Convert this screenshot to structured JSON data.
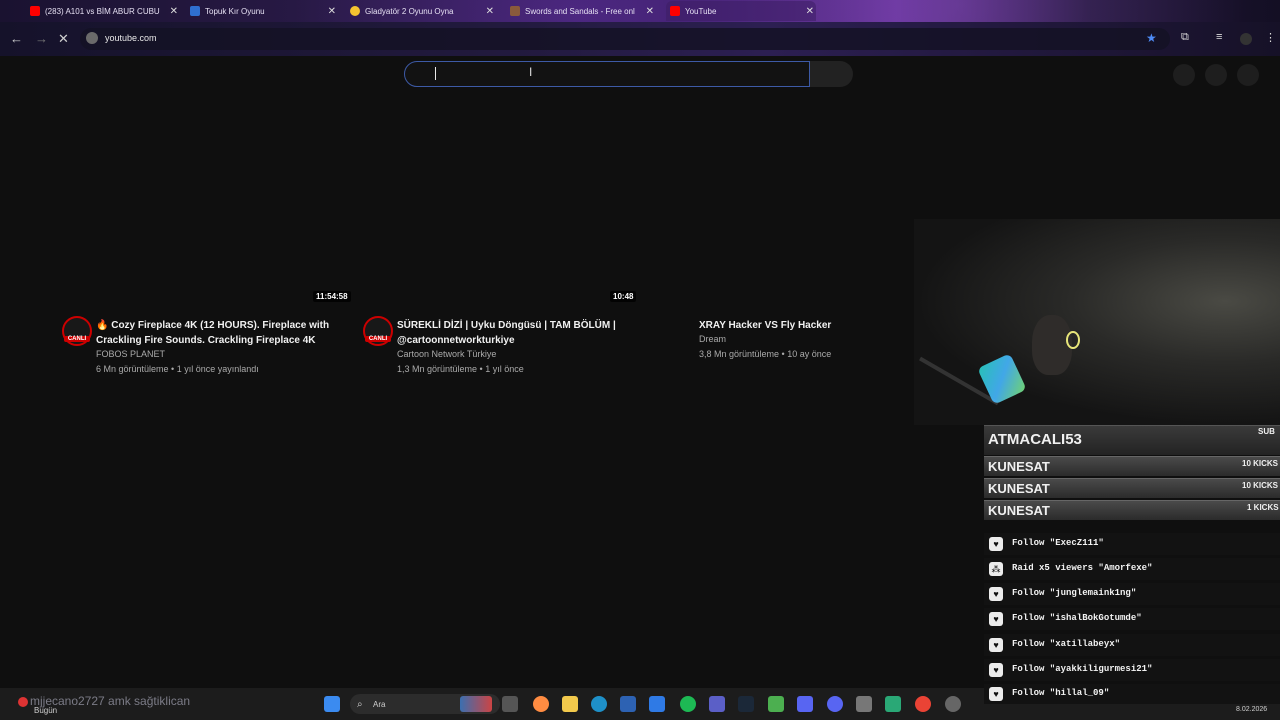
{
  "browser": {
    "tabs": [
      {
        "title": "(283) A101 vs BİM ABUR CUBU",
        "favicon_color": "#ff0000"
      },
      {
        "title": "Topuk Kır Oyunu",
        "favicon_color": "#2f6fcf"
      },
      {
        "title": "Gladyatör 2 Oyunu Oyna",
        "favicon_color": "#f4c430"
      },
      {
        "title": "Swords and Sandals - Free onl",
        "favicon_color": "#8a5a3c"
      },
      {
        "title": "YouTube",
        "favicon_color": "#ff0000"
      }
    ],
    "url": "youtube.com"
  },
  "youtube": {
    "search_value": "",
    "videos": [
      {
        "duration": "11:54:58",
        "title_line1": "🔥 Cozy Fireplace 4K (12 HOURS). Fireplace with",
        "title_line2": "Crackling Fire Sounds. Crackling Fireplace 4K",
        "channel": "FOBOS PLANET",
        "meta": "6 Mn görüntüleme • 1 yıl önce yayınlandı",
        "live_label": "CANLI"
      },
      {
        "duration": "10:48",
        "title_line1": "SÜREKLİ DİZİ | Uyku Döngüsü | TAM BÖLÜM |",
        "title_line2": "@cartoonnetworkturkiye",
        "channel": "Cartoon Network Türkiye",
        "meta": "1,3 Mn görüntüleme • 1 yıl önce",
        "live_label": "CANLI"
      },
      {
        "title_line1": "XRAY Hacker VS Fly Hacker",
        "channel": "Dream",
        "meta": "3,8 Mn görüntüleme • 10 ay önce"
      }
    ]
  },
  "overlay": {
    "sub": {
      "name": "ATMACALI53",
      "tag": "SUB"
    },
    "kicks": [
      {
        "name": "KUNESAT",
        "amount": "10 KICKS"
      },
      {
        "name": "KUNESAT",
        "amount": "10 KICKS"
      },
      {
        "name": "KUNESAT",
        "amount": "1 KICKS"
      }
    ],
    "events": [
      {
        "icon": "heart-icon",
        "text": "Follow \"ExecZ111\""
      },
      {
        "icon": "raid-icon",
        "text": "Raid x5 viewers \"Amorfexe\""
      },
      {
        "icon": "heart-icon",
        "text": "Follow \"junglemaink1ng\""
      },
      {
        "icon": "heart-icon",
        "text": "Follow \"ishalBokGotumde\""
      },
      {
        "icon": "heart-icon",
        "text": "Follow \"xatillabeyx\""
      },
      {
        "icon": "heart-icon",
        "text": "Follow \"ayakkiligurmesi21\""
      },
      {
        "icon": "heart-icon",
        "text": "Follow \"hillal_09\""
      }
    ],
    "chat_line": "mjjecano2727  amk sağtiklican"
  },
  "taskbar": {
    "search_placeholder": "Ara",
    "weather_label": "Bugün",
    "date": "8.02.2026"
  },
  "colors": {
    "yt_bg": "#0f0f0f",
    "live_red": "#cc0000",
    "search_focus": "#3d5aa6"
  }
}
